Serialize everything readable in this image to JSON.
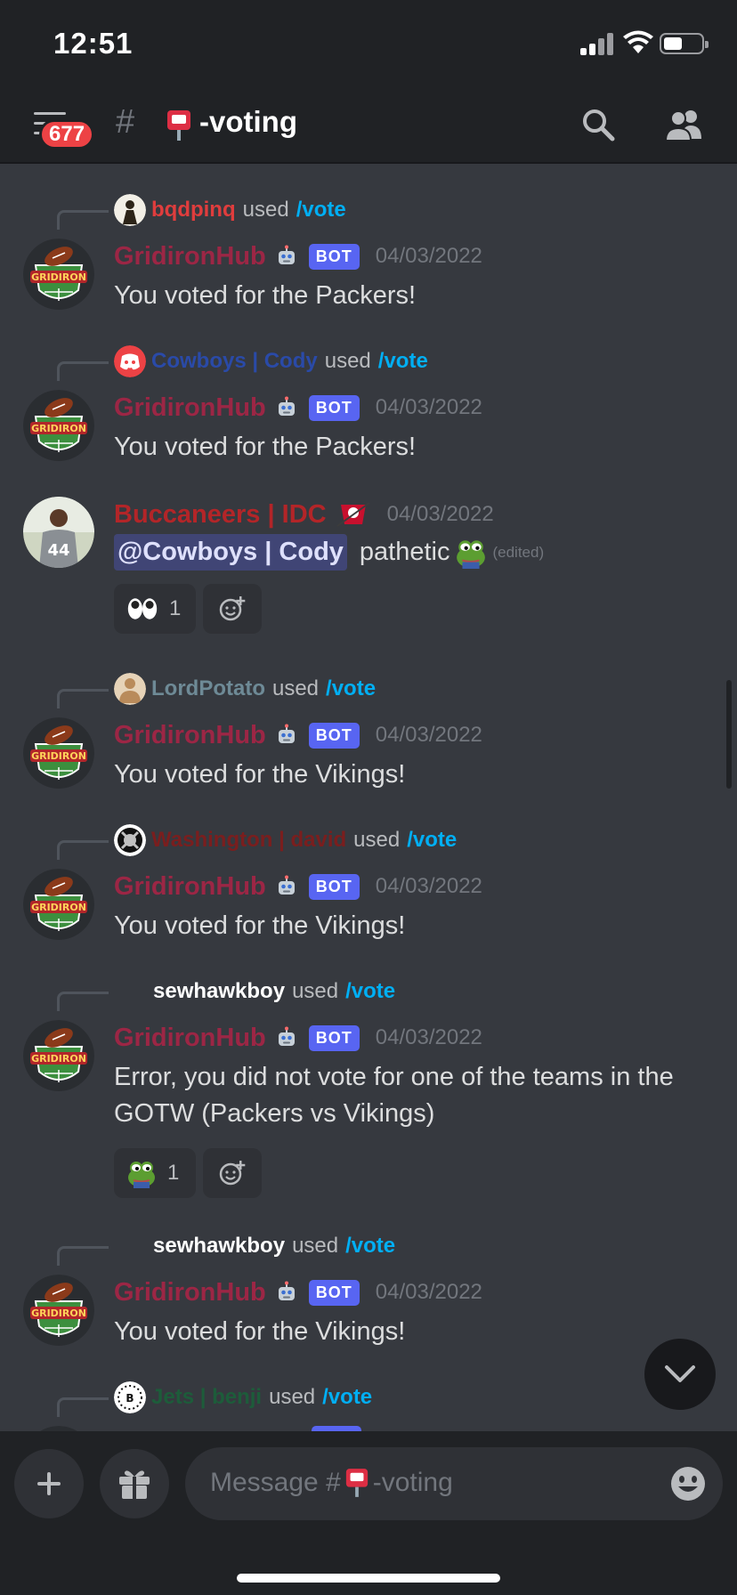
{
  "status_bar": {
    "time": "12:51"
  },
  "header": {
    "unread_badge": "677",
    "channel_name": "-voting",
    "channel_icon": "mailbox-icon"
  },
  "bot": {
    "name": "GridironHub",
    "tag": "BOT"
  },
  "messages": [
    {
      "reply_user": "bqdpinq",
      "reply_user_color": "#e03d3d",
      "used": "used",
      "command": "/vote",
      "author": "GridironHub",
      "timestamp": "04/03/2022",
      "content": "You voted for the Packers!"
    },
    {
      "reply_user": "Cowboys | Cody",
      "reply_user_color": "#2a4aa8",
      "used": "used",
      "command": "/vote",
      "author": "GridironHub",
      "timestamp": "04/03/2022",
      "content": "You voted for the Packers!"
    },
    {
      "author": "Buccaneers | IDC",
      "author_color": "#b32528",
      "timestamp": "04/03/2022",
      "mention": "@Cowboys | Cody",
      "content": "pathetic",
      "edited": "(edited)",
      "reactions": [
        {
          "emoji": "eyes-emoji",
          "count": "1"
        }
      ]
    },
    {
      "reply_user": "LordPotato",
      "reply_user_color": "#6e8a96",
      "used": "used",
      "command": "/vote",
      "author": "GridironHub",
      "timestamp": "04/03/2022",
      "content": "You voted for the Vikings!"
    },
    {
      "reply_user": "Washington | david",
      "reply_user_color": "#7a1e1e",
      "used": "used",
      "command": "/vote",
      "author": "GridironHub",
      "timestamp": "04/03/2022",
      "content": "You voted for the Vikings!"
    },
    {
      "reply_user": "sewhawkboy",
      "reply_user_color": "#ffffff",
      "used": "used",
      "command": "/vote",
      "author": "GridironHub",
      "timestamp": "04/03/2022",
      "content": "Error, you did not vote for one of the teams in the GOTW (Packers vs Vikings)",
      "reactions": [
        {
          "emoji": "pepe-emoji",
          "count": "1"
        }
      ]
    },
    {
      "reply_user": "sewhawkboy",
      "reply_user_color": "#ffffff",
      "used": "used",
      "command": "/vote",
      "author": "GridironHub",
      "timestamp": "04/03/2022",
      "content": "You voted for the Vikings!"
    },
    {
      "reply_user": "Jets | benji",
      "reply_user_color": "#1d5c3a",
      "used": "used",
      "command": "/vote"
    }
  ],
  "composer": {
    "placeholder_prefix": "Message #",
    "placeholder_channel": "-voting"
  },
  "colors": {
    "bot_name": "#9c2645",
    "bot_tag": "#5865f2",
    "link": "#00aff4",
    "background": "#36393f"
  }
}
